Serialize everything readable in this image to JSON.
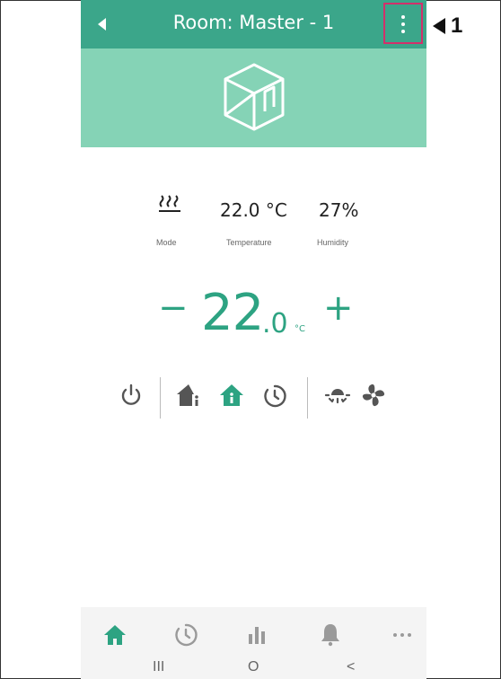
{
  "header": {
    "title": "Room: Master - 1"
  },
  "callout": {
    "label": "1"
  },
  "stats": {
    "temperature_value": "22.0 °C",
    "humidity_value": "27%",
    "mode_label": "Mode",
    "temperature_label": "Temperature",
    "humidity_label": "Humidity"
  },
  "setpoint": {
    "minus": "−",
    "plus": "+",
    "integer": "22",
    "decimal": ".0",
    "unit": "°C"
  },
  "system_nav": {
    "recents": "III",
    "home": "O",
    "back": "<"
  },
  "colors": {
    "header": "#3ba68a",
    "banner": "#85d3b6",
    "accent": "#2da382",
    "highlight_box": "#d3306b"
  },
  "icons": {
    "back": "back-arrow-icon",
    "menu": "kebab-menu-icon",
    "room": "room-cube-icon",
    "mode": "heating-waves-icon",
    "power": "power-icon",
    "home_info": "home-info-icon",
    "home_active": "home-active-icon",
    "schedule": "schedule-icon",
    "sun": "sun-icon",
    "fan": "fan-icon",
    "nav_home": "home-icon",
    "nav_schedule": "schedule-icon",
    "nav_stats": "bar-chart-icon",
    "nav_alerts": "bell-icon",
    "nav_more": "more-dots-icon"
  }
}
